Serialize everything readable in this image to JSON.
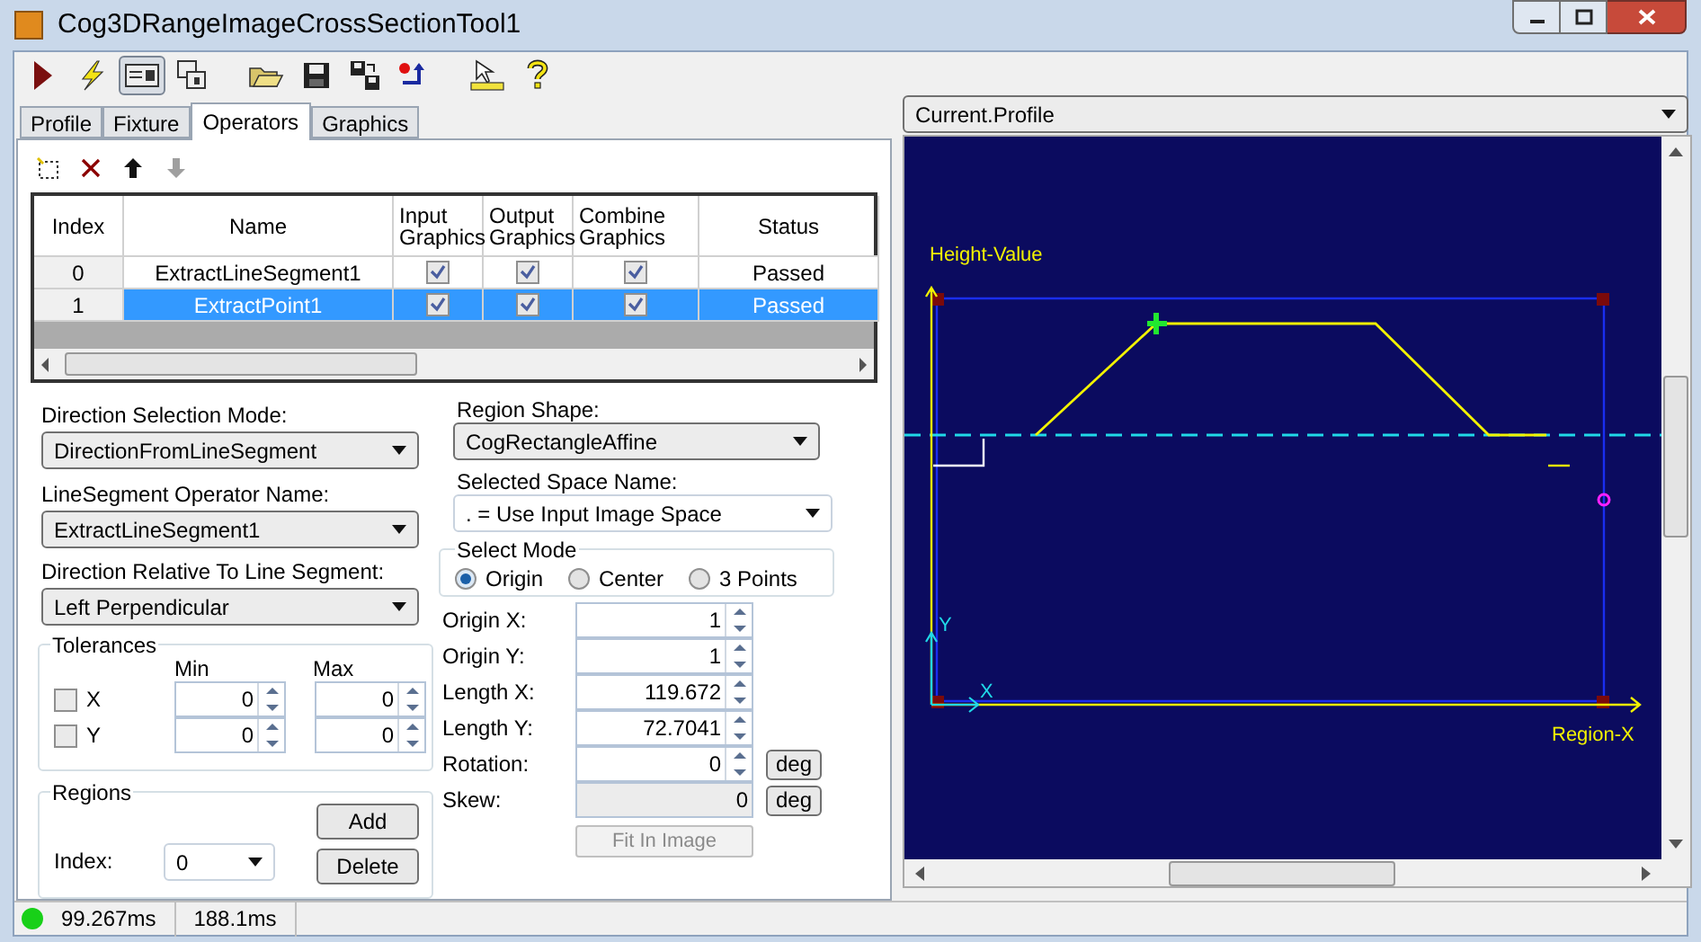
{
  "window": {
    "title": "Cog3DRangeImageCrossSectionTool1"
  },
  "toolbar": [
    {
      "kind": "run",
      "pressed": false
    },
    {
      "kind": "electric",
      "pressed": false
    },
    {
      "kind": "panel",
      "pressed": true
    },
    {
      "kind": "floating",
      "pressed": false
    },
    {
      "kind": "open",
      "pressed": false
    },
    {
      "kind": "save",
      "pressed": false
    },
    {
      "kind": "save-as",
      "pressed": false
    },
    {
      "kind": "reset",
      "pressed": false
    },
    {
      "kind": "pointer",
      "pressed": false
    },
    {
      "kind": "help",
      "pressed": false
    }
  ],
  "tabs": [
    {
      "label": "Profile",
      "selected": false
    },
    {
      "label": "Fixture",
      "selected": false
    },
    {
      "label": "Operators",
      "selected": true
    },
    {
      "label": "Graphics",
      "selected": false
    }
  ],
  "operators": {
    "actions": [
      {
        "kind": "new",
        "disabled": false
      },
      {
        "kind": "delete",
        "disabled": false
      },
      {
        "kind": "up",
        "disabled": false
      },
      {
        "kind": "down",
        "disabled": true
      }
    ],
    "columns": [
      "Index",
      "Name",
      "Input Graphics",
      "Output Graphics",
      "Combine Graphics",
      "Status"
    ],
    "rows": [
      {
        "index": "0",
        "name": "ExtractLineSegment1",
        "input_graphics": true,
        "output_graphics": true,
        "combine_graphics": true,
        "status": "Passed",
        "selected": false
      },
      {
        "index": "1",
        "name": "ExtractPoint1",
        "input_graphics": true,
        "output_graphics": true,
        "combine_graphics": true,
        "status": "Passed",
        "selected": true
      }
    ]
  },
  "direction": {
    "mode_label": "Direction Selection Mode:",
    "mode": "DirectionFromLineSegment",
    "operator_label": "LineSegment Operator Name:",
    "operator": "ExtractLineSegment1",
    "relative_label": "Direction Relative To Line Segment:",
    "relative": "Left Perpendicular"
  },
  "tolerances": {
    "title": "Tolerances",
    "min_label": "Min",
    "max_label": "Max",
    "rows": [
      {
        "label": "X",
        "checked": false,
        "min": "0",
        "max": "0"
      },
      {
        "label": "Y",
        "checked": false,
        "min": "0",
        "max": "0"
      }
    ]
  },
  "regions": {
    "title": "Regions",
    "add": "Add",
    "delete": "Delete",
    "index_label": "Index:",
    "index": "0"
  },
  "region": {
    "shape_label": "Region Shape:",
    "shape": "CogRectangleAffine",
    "space_label": "Selected Space Name:",
    "space": ". = Use Input Image Space",
    "mode_title": "Select Mode",
    "modes": [
      {
        "label": "Origin",
        "selected": true
      },
      {
        "label": "Center",
        "selected": false
      },
      {
        "label": "3 Points",
        "selected": false
      }
    ],
    "fields": [
      {
        "label": "Origin X:",
        "value": "1",
        "disabled": false
      },
      {
        "label": "Origin Y:",
        "value": "1",
        "disabled": false
      },
      {
        "label": "Length X:",
        "value": "119.672",
        "disabled": false
      },
      {
        "label": "Length Y:",
        "value": "72.7041",
        "disabled": false
      },
      {
        "label": "Rotation:",
        "value": "0",
        "disabled": false,
        "unit": "deg"
      },
      {
        "label": "Skew:",
        "value": "0",
        "disabled": true,
        "unit": "deg"
      }
    ],
    "fit": {
      "label": "Fit In Image",
      "disabled": true
    }
  },
  "display": {
    "source": "Current.Profile",
    "y_label": "Height-Value",
    "x_label": "Region-X",
    "axis_x": "X",
    "axis_y": "Y"
  },
  "status_bar": {
    "passed": true,
    "times": [
      "99.267ms",
      "188.1ms"
    ]
  }
}
